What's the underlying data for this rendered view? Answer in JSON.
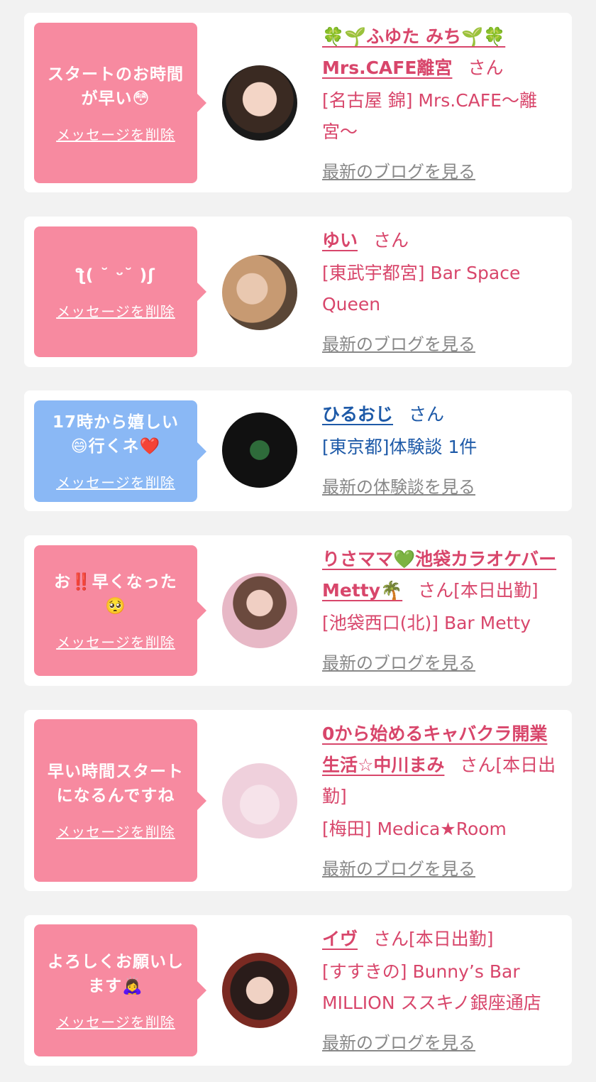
{
  "cards": [
    {
      "message": "スタートのお時間が早い😳",
      "delete_label": "メッセージを削除",
      "name": "🍀🌱ふゆた みち🌱🍀 Mrs.CAFE離宮",
      "suffix": "さん",
      "shop": "[名古屋 錦] Mrs.CAFE〜離宮〜",
      "link": "最新のブログを見る"
    },
    {
      "message": "ƪ( ˘ ᵕ˘ )ʃ",
      "delete_label": "メッセージを削除",
      "name": "ゆい",
      "suffix": "さん",
      "shop": "[東武宇都宮] Bar Space Queen",
      "link": "最新のブログを見る"
    },
    {
      "message": "17時から嬉しい😄行くネ❤️",
      "delete_label": "メッセージを削除",
      "name": "ひるおじ",
      "suffix": "さん",
      "shop": "[東京都]体験談 1件",
      "link": "最新の体験談を見る"
    },
    {
      "message": "お‼️早くなった🥺",
      "delete_label": "メッセージを削除",
      "name": "りさママ💚池袋カラオケバーMetty🌴",
      "suffix": "さん[本日出勤]",
      "shop": "[池袋西口(北)] Bar Metty",
      "link": "最新のブログを見る"
    },
    {
      "message": "早い時間スタートになるんですね",
      "delete_label": "メッセージを削除",
      "name": "0から始めるキャバクラ開業生活☆中川まみ",
      "suffix": "さん[本日出勤]",
      "shop": "[梅田] Medica★Room",
      "link": "最新のブログを見る"
    },
    {
      "message": "よろしくお願いします🙇‍♀️",
      "delete_label": "メッセージを削除",
      "name": "イヴ",
      "suffix": "さん[本日出勤]",
      "shop": "[すすきの] Bunny’s Bar MILLION ススキノ銀座通店",
      "link": "最新のブログを見る"
    }
  ],
  "colors": {
    "bubble_pink": "#f78aa0",
    "bubble_blue": "#8ab8f5",
    "name_pink": "#d8466b",
    "name_blue": "#1e5aa8",
    "link_gray": "#888888",
    "page_bg": "#f2f2f2"
  }
}
